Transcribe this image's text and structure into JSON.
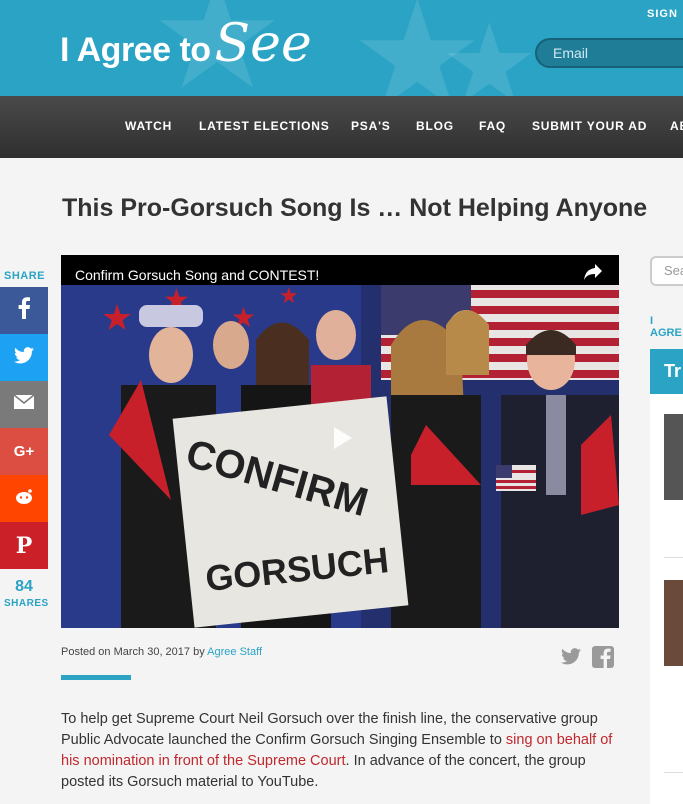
{
  "header": {
    "logo_text": "I Agree to",
    "logo_script": "See",
    "signin": "SIGN",
    "email_placeholder": "Email"
  },
  "nav": {
    "items": [
      "WATCH",
      "LATEST ELECTIONS",
      "PSA'S",
      "BLOG",
      "FAQ",
      "SUBMIT YOUR AD",
      "AB"
    ]
  },
  "article": {
    "title": "This Pro-Gorsuch Song Is … Not Helping Anyone",
    "video": {
      "title": "Confirm Gorsuch Song and CONTEST!",
      "sign_line1": "CONFIRM",
      "sign_line2": "GORSUCH"
    },
    "posted_prefix": "Posted on March 30, 2017 by",
    "author": "Agree Staff",
    "body_before_link": "To help get Supreme Court Neil Gorsuch over the finish line, the conservative group Public Advocate launched the Confirm Gorsuch Singing Ensemble to ",
    "body_link": "sing on behalf of his nomination in front of the Supreme Court",
    "body_after_link": ". In advance of the concert, the group posted its Gorsuch material to YouTube."
  },
  "share": {
    "label": "SHARE",
    "count": "84",
    "count_label": "SHARES",
    "buttons": [
      {
        "name": "facebook",
        "color": "#3b5998",
        "glyph": "f"
      },
      {
        "name": "twitter",
        "color": "#1da1f2",
        "glyph": "t"
      },
      {
        "name": "email",
        "color": "#7a7a7a",
        "glyph": "m"
      },
      {
        "name": "google-plus",
        "color": "#dc4e41",
        "glyph": "G+"
      },
      {
        "name": "reddit",
        "color": "#ff4500",
        "glyph": "r"
      },
      {
        "name": "pinterest",
        "color": "#cb2027",
        "glyph": "P"
      }
    ]
  },
  "sidebar": {
    "search_placeholder": "Sea",
    "heading": "I AGRE",
    "box_title": "Tr"
  },
  "colors": {
    "accent": "#2aa3c4",
    "link_red": "#c0282d",
    "nav_bg": "#3a3a3a"
  }
}
